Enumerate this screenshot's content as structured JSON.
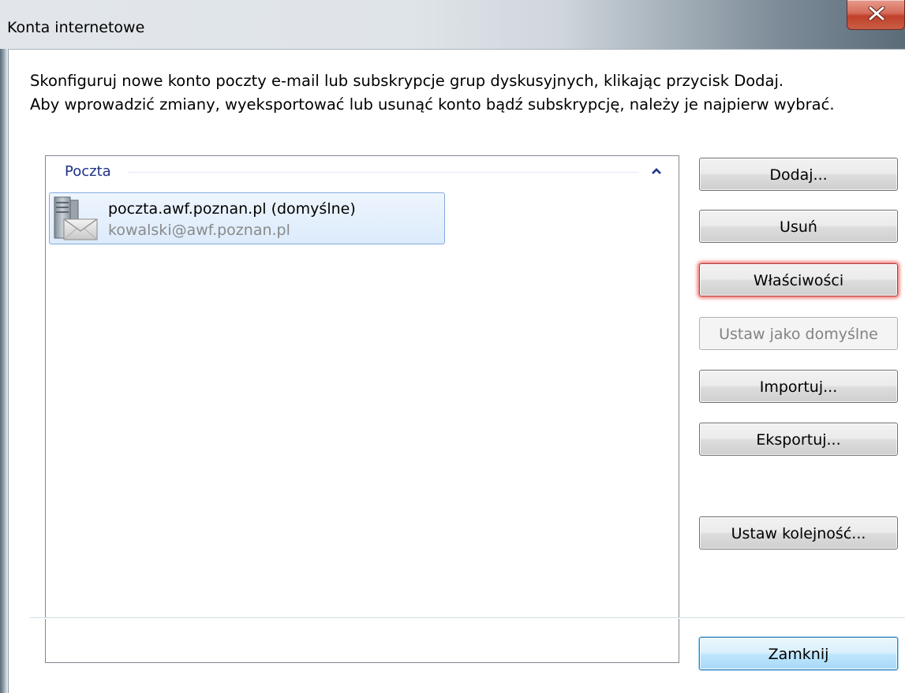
{
  "window": {
    "title": "Konta internetowe"
  },
  "intro": {
    "line1": "Skonfiguruj nowe konto poczty e-mail lub subskrypcje grup dyskusyjnych, klikając przycisk Dodaj.",
    "line2": "Aby wprowadzić zmiany, wyeksportować lub usunąć konto bądź subskrypcję, należy je najpierw wybrać."
  },
  "accounts": {
    "group_label": "Poczta",
    "items": [
      {
        "name": "poczta.awf.poznan.pl (domyślne)",
        "email": "kowalski@awf.poznan.pl"
      }
    ]
  },
  "buttons": {
    "add": "Dodaj...",
    "remove": "Usuń",
    "properties": "Właściwości",
    "set_default": "Ustaw jako domyślne",
    "import": "Importuj...",
    "export": "Eksportuj...",
    "set_order": "Ustaw kolejność...",
    "close": "Zamknij"
  },
  "colors": {
    "group_header": "#1e3287",
    "selection_border": "#84acdd",
    "focus_glow": "#e53935",
    "close_button": "#c0412a"
  },
  "icons": {
    "close": "close-icon",
    "collapse": "chevron-up-icon",
    "account": "mail-server-icon"
  }
}
